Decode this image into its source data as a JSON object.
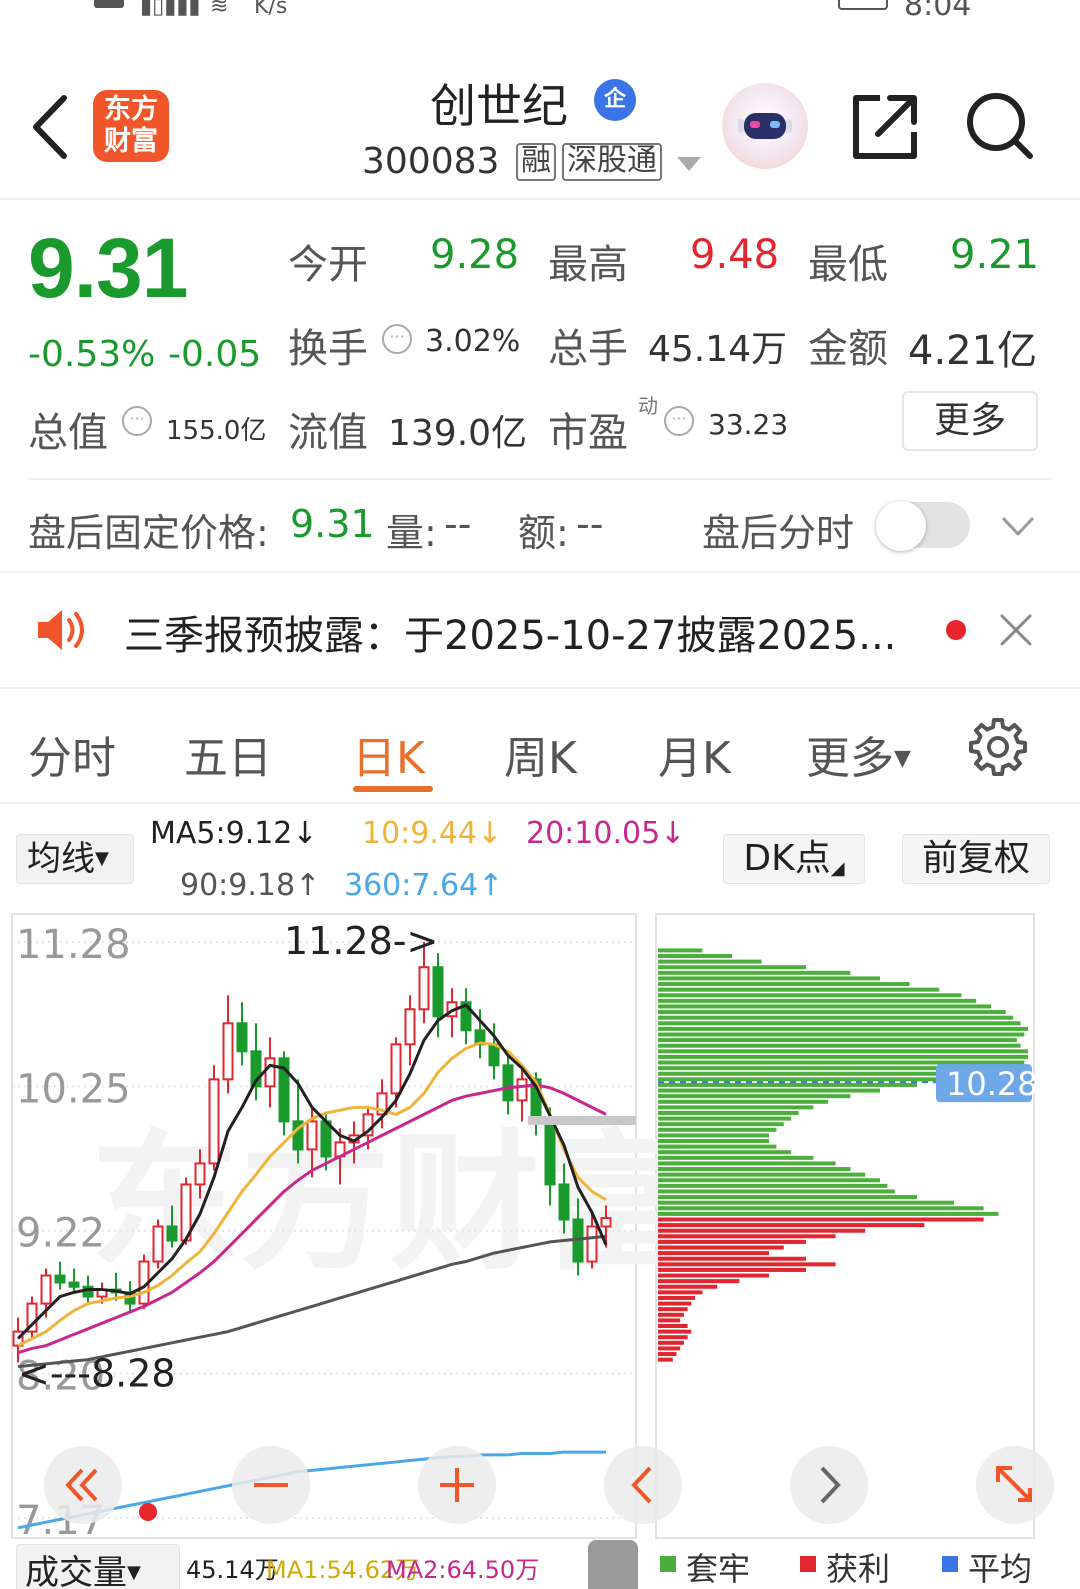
{
  "status_bar": {
    "network_speed": "K/s",
    "clock": "8:04"
  },
  "header": {
    "logo_line1": "东方",
    "logo_line2": "财富",
    "title": "创世纪",
    "enterprise_badge": "企",
    "code": "300083",
    "tags": [
      "融",
      "深股通"
    ]
  },
  "quote": {
    "price": "9.31",
    "change_pct": "-0.53%",
    "change": "-0.05",
    "open_label": "今开",
    "open": "9.28",
    "high_label": "最高",
    "high": "9.48",
    "low_label": "最低",
    "low": "9.21",
    "turnover_label": "换手",
    "turnover": "3.02%",
    "volume_label": "总手",
    "volume": "45.14万",
    "amount_label": "金额",
    "amount": "4.21亿",
    "mktcap_label": "总值",
    "mktcap": "155.0亿",
    "float_label": "流值",
    "float_cap": "139.0亿",
    "pe_label": "市盈",
    "pe_superscript": "动",
    "pe": "33.23",
    "more_label": "更多"
  },
  "after_hours": {
    "price_label": "盘后固定价格:",
    "price": "9.31",
    "vol_label": "量:",
    "vol": "--",
    "amt_label": "额:",
    "amt": "--",
    "timeshare_label": "盘后分时"
  },
  "notice": {
    "text": "三季报预披露：于2025-10-27披露2025..."
  },
  "tabs": [
    {
      "label": "分时"
    },
    {
      "label": "五日"
    },
    {
      "label": "日K"
    },
    {
      "label": "周K"
    },
    {
      "label": "月K"
    },
    {
      "label": "更多"
    }
  ],
  "indicator": {
    "ma_button": "均线",
    "ma5": "MA5:9.12↓",
    "ma10": "10:9.44↓",
    "ma20": "20:10.05↓",
    "ma90": "90:9.18↑",
    "ma360": "360:7.64↑",
    "dk_button": "DK点",
    "adjust_button": "前复权",
    "colors": {
      "ma5": "#222222",
      "ma10": "#f0b43c",
      "ma20": "#c8288c",
      "ma90": "#555555",
      "ma360": "#4aa8e6"
    }
  },
  "chart_data": {
    "type": "candlestick",
    "y_tick_labels": [
      "11.28",
      "10.25",
      "9.22",
      "8.20",
      "7.17"
    ],
    "high_annotation": "11.28->",
    "low_annotation": "<---8.28",
    "price_profile_marker": "10.28",
    "colors": {
      "up": "#e0262f",
      "down": "#1a9a2c",
      "profile_above": "#4caf3c",
      "profile_below": "#e0262f"
    },
    "ohlc": [
      [
        8.4,
        8.6,
        8.28,
        8.5
      ],
      [
        8.5,
        8.75,
        8.45,
        8.7
      ],
      [
        8.7,
        8.95,
        8.6,
        8.9
      ],
      [
        8.9,
        9.0,
        8.8,
        8.85
      ],
      [
        8.85,
        8.95,
        8.78,
        8.82
      ],
      [
        8.82,
        8.9,
        8.7,
        8.75
      ],
      [
        8.75,
        8.85,
        8.7,
        8.8
      ],
      [
        8.8,
        8.92,
        8.72,
        8.78
      ],
      [
        8.78,
        8.86,
        8.65,
        8.7
      ],
      [
        8.7,
        9.05,
        8.66,
        9.0
      ],
      [
        9.0,
        9.3,
        8.95,
        9.25
      ],
      [
        9.25,
        9.4,
        9.1,
        9.15
      ],
      [
        9.15,
        9.6,
        9.12,
        9.55
      ],
      [
        9.55,
        9.8,
        9.45,
        9.7
      ],
      [
        9.7,
        10.4,
        9.65,
        10.3
      ],
      [
        10.3,
        10.9,
        10.2,
        10.7
      ],
      [
        10.7,
        10.85,
        10.4,
        10.5
      ],
      [
        10.5,
        10.7,
        10.15,
        10.25
      ],
      [
        10.25,
        10.6,
        10.1,
        10.45
      ],
      [
        10.45,
        10.5,
        9.9,
        10.0
      ],
      [
        10.0,
        10.3,
        9.7,
        9.8
      ],
      [
        9.8,
        10.1,
        9.6,
        10.0
      ],
      [
        10.0,
        10.05,
        9.65,
        9.75
      ],
      [
        9.75,
        9.95,
        9.55,
        9.85
      ],
      [
        9.85,
        10.0,
        9.7,
        9.9
      ],
      [
        9.9,
        10.1,
        9.8,
        10.05
      ],
      [
        10.05,
        10.3,
        9.95,
        10.2
      ],
      [
        10.2,
        10.6,
        10.1,
        10.55
      ],
      [
        10.55,
        10.9,
        10.4,
        10.8
      ],
      [
        10.8,
        11.28,
        10.7,
        11.1
      ],
      [
        11.1,
        11.2,
        10.6,
        10.75
      ],
      [
        10.75,
        10.95,
        10.6,
        10.85
      ],
      [
        10.85,
        10.95,
        10.55,
        10.65
      ],
      [
        10.65,
        10.8,
        10.45,
        10.55
      ],
      [
        10.55,
        10.7,
        10.3,
        10.4
      ],
      [
        10.4,
        10.5,
        10.05,
        10.15
      ],
      [
        10.15,
        10.4,
        10.0,
        10.3
      ],
      [
        10.3,
        10.35,
        9.9,
        10.0
      ],
      [
        10.0,
        10.1,
        9.4,
        9.55
      ],
      [
        9.55,
        9.7,
        9.2,
        9.3
      ],
      [
        9.3,
        9.45,
        8.9,
        9.0
      ],
      [
        9.0,
        9.35,
        8.95,
        9.25
      ],
      [
        9.25,
        9.4,
        9.1,
        9.31
      ]
    ],
    "ma5": [
      8.45,
      8.55,
      8.65,
      8.75,
      8.78,
      8.8,
      8.8,
      8.79,
      8.77,
      8.82,
      8.92,
      9.02,
      9.16,
      9.34,
      9.6,
      9.93,
      10.1,
      10.29,
      10.4,
      10.38,
      10.27,
      10.1,
      10.0,
      9.9,
      9.86,
      9.93,
      10.03,
      10.15,
      10.34,
      10.58,
      10.72,
      10.79,
      10.83,
      10.72,
      10.61,
      10.47,
      10.38,
      10.25,
      10.04,
      9.83,
      9.53,
      9.35,
      9.12
    ],
    "ma10": [
      8.4,
      8.45,
      8.5,
      8.58,
      8.65,
      8.7,
      8.72,
      8.74,
      8.75,
      8.78,
      8.83,
      8.9,
      8.99,
      9.07,
      9.2,
      9.35,
      9.5,
      9.62,
      9.75,
      9.85,
      9.95,
      10.02,
      10.06,
      10.08,
      10.1,
      10.1,
      10.08,
      10.05,
      10.1,
      10.2,
      10.35,
      10.45,
      10.52,
      10.56,
      10.55,
      10.5,
      10.4,
      10.28,
      10.05,
      9.8,
      9.6,
      9.5,
      9.44
    ],
    "ma20": [
      8.35,
      8.38,
      8.4,
      8.44,
      8.48,
      8.52,
      8.56,
      8.6,
      8.64,
      8.68,
      8.73,
      8.78,
      8.85,
      8.92,
      9.0,
      9.1,
      9.2,
      9.3,
      9.4,
      9.5,
      9.58,
      9.65,
      9.7,
      9.75,
      9.8,
      9.85,
      9.9,
      9.95,
      10.0,
      10.05,
      10.1,
      10.15,
      10.18,
      10.2,
      10.22,
      10.24,
      10.25,
      10.26,
      10.24,
      10.2,
      10.15,
      10.1,
      10.05
    ],
    "ma90": [
      8.25,
      8.26,
      8.27,
      8.28,
      8.29,
      8.3,
      8.32,
      8.34,
      8.36,
      8.38,
      8.4,
      8.42,
      8.44,
      8.46,
      8.48,
      8.5,
      8.53,
      8.56,
      8.59,
      8.62,
      8.65,
      8.68,
      8.71,
      8.74,
      8.77,
      8.8,
      8.83,
      8.86,
      8.89,
      8.92,
      8.95,
      8.98,
      9.0,
      9.03,
      9.06,
      9.08,
      9.1,
      9.12,
      9.14,
      9.15,
      9.16,
      9.17,
      9.18
    ],
    "ma360": [
      7.1,
      7.12,
      7.14,
      7.16,
      7.18,
      7.2,
      7.22,
      7.24,
      7.26,
      7.28,
      7.3,
      7.32,
      7.34,
      7.36,
      7.38,
      7.4,
      7.42,
      7.44,
      7.46,
      7.48,
      7.5,
      7.51,
      7.52,
      7.53,
      7.54,
      7.55,
      7.56,
      7.57,
      7.58,
      7.59,
      7.6,
      7.61,
      7.61,
      7.62,
      7.62,
      7.62,
      7.63,
      7.63,
      7.63,
      7.64,
      7.64,
      7.64,
      7.64
    ],
    "volume_profile": [
      [
        11.22,
        0.12
      ],
      [
        11.18,
        0.2
      ],
      [
        11.14,
        0.28
      ],
      [
        11.1,
        0.4
      ],
      [
        11.06,
        0.52
      ],
      [
        11.02,
        0.6
      ],
      [
        10.98,
        0.68
      ],
      [
        10.94,
        0.76
      ],
      [
        10.9,
        0.82
      ],
      [
        10.86,
        0.86
      ],
      [
        10.82,
        0.9
      ],
      [
        10.78,
        0.94
      ],
      [
        10.74,
        0.96
      ],
      [
        10.7,
        0.98
      ],
      [
        10.66,
        1.0
      ],
      [
        10.62,
        0.99
      ],
      [
        10.58,
        0.97
      ],
      [
        10.54,
        0.98
      ],
      [
        10.5,
        1.0
      ],
      [
        10.46,
        1.0
      ],
      [
        10.42,
        0.99
      ],
      [
        10.38,
        0.98
      ],
      [
        10.34,
        0.9
      ],
      [
        10.3,
        0.8
      ],
      [
        10.26,
        0.7
      ],
      [
        10.22,
        0.6
      ],
      [
        10.18,
        0.52
      ],
      [
        10.14,
        0.46
      ],
      [
        10.1,
        0.42
      ],
      [
        10.06,
        0.38
      ],
      [
        10.02,
        0.36
      ],
      [
        9.98,
        0.34
      ],
      [
        9.94,
        0.32
      ],
      [
        9.9,
        0.3
      ],
      [
        9.86,
        0.3
      ],
      [
        9.82,
        0.32
      ],
      [
        9.78,
        0.36
      ],
      [
        9.74,
        0.42
      ],
      [
        9.7,
        0.48
      ],
      [
        9.66,
        0.52
      ],
      [
        9.62,
        0.56
      ],
      [
        9.58,
        0.6
      ],
      [
        9.54,
        0.62
      ],
      [
        9.5,
        0.64
      ],
      [
        9.46,
        0.7
      ],
      [
        9.42,
        0.8
      ],
      [
        9.38,
        0.88
      ],
      [
        9.34,
        0.92
      ],
      [
        9.3,
        0.88
      ],
      [
        9.26,
        0.72
      ],
      [
        9.22,
        0.56
      ],
      [
        9.18,
        0.48
      ],
      [
        9.14,
        0.4
      ],
      [
        9.1,
        0.34
      ],
      [
        9.06,
        0.3
      ],
      [
        9.02,
        0.4
      ],
      [
        8.98,
        0.48
      ],
      [
        8.94,
        0.4
      ],
      [
        8.9,
        0.3
      ],
      [
        8.86,
        0.22
      ],
      [
        8.82,
        0.16
      ],
      [
        8.78,
        0.12
      ],
      [
        8.74,
        0.1
      ],
      [
        8.7,
        0.09
      ],
      [
        8.66,
        0.08
      ],
      [
        8.62,
        0.07
      ],
      [
        8.58,
        0.06
      ],
      [
        8.54,
        0.08
      ],
      [
        8.5,
        0.09
      ],
      [
        8.46,
        0.08
      ],
      [
        8.42,
        0.07
      ],
      [
        8.38,
        0.06
      ],
      [
        8.34,
        0.05
      ],
      [
        8.3,
        0.04
      ]
    ]
  },
  "chart_controls": [
    "rewind",
    "zoom-out",
    "zoom-in",
    "prev",
    "next",
    "fullscreen"
  ],
  "bottom": {
    "volume_label": "成交量",
    "volume_value": "45.14万",
    "vol_ma1": "MA1:54.62万",
    "vol_ma2": "MA2:64.50万",
    "legend": [
      "套牢",
      "获利",
      "平均"
    ]
  }
}
